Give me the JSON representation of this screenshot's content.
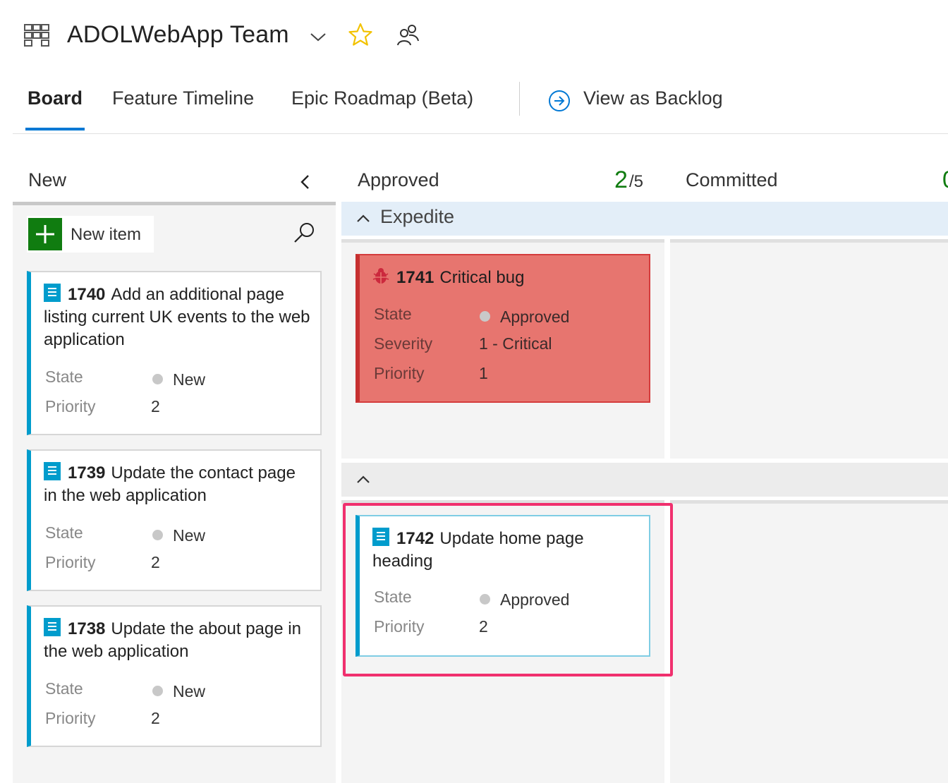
{
  "header": {
    "team_name": "ADOLWebApp Team"
  },
  "tabs": [
    {
      "label": "Board",
      "active": true
    },
    {
      "label": "Feature Timeline"
    },
    {
      "label": "Epic Roadmap (Beta)"
    }
  ],
  "view_as_backlog": "View as Backlog",
  "columns": {
    "new": {
      "title": "New"
    },
    "approved": {
      "title": "Approved",
      "wip_count": "2",
      "wip_limit": "/5"
    },
    "committed": {
      "title": "Committed"
    }
  },
  "new_item_label": "New item",
  "new_cards": [
    {
      "id": "1740",
      "title": "Add an additional page listing current UK events to the web application",
      "state_label": "State",
      "state": "New",
      "priority_label": "Priority",
      "priority": "2"
    },
    {
      "id": "1739",
      "title": "Update the contact page in the web application",
      "state_label": "State",
      "state": "New",
      "priority_label": "Priority",
      "priority": "2"
    },
    {
      "id": "1738",
      "title": "Update the about page in the web application",
      "state_label": "State",
      "state": "New",
      "priority_label": "Priority",
      "priority": "2"
    }
  ],
  "swimlanes": {
    "expedite": {
      "title": "Expedite"
    },
    "default": {
      "title": ""
    }
  },
  "bug_card": {
    "id": "1741",
    "title": "Critical bug",
    "state_label": "State",
    "state": "Approved",
    "severity_label": "Severity",
    "severity": "1 - Critical",
    "priority_label": "Priority",
    "priority": "1"
  },
  "approved_card": {
    "id": "1742",
    "title": "Update home page heading",
    "state_label": "State",
    "state": "Approved",
    "priority_label": "Priority",
    "priority": "2"
  },
  "colors": {
    "accent": "#0078d4",
    "wip_ok": "#107c10",
    "user_story_bar": "#009ccc",
    "bug_background": "#e7756f",
    "expedite_lane": "#e3eef8",
    "highlight": "#f0306e"
  },
  "icons": [
    "team-board-icon",
    "chevron-down-icon",
    "star-icon",
    "people-icon",
    "arrow-circle-right-icon",
    "chevron-left-icon",
    "plus-icon",
    "search-icon",
    "user-story-icon",
    "bug-icon",
    "chevron-up-icon"
  ]
}
